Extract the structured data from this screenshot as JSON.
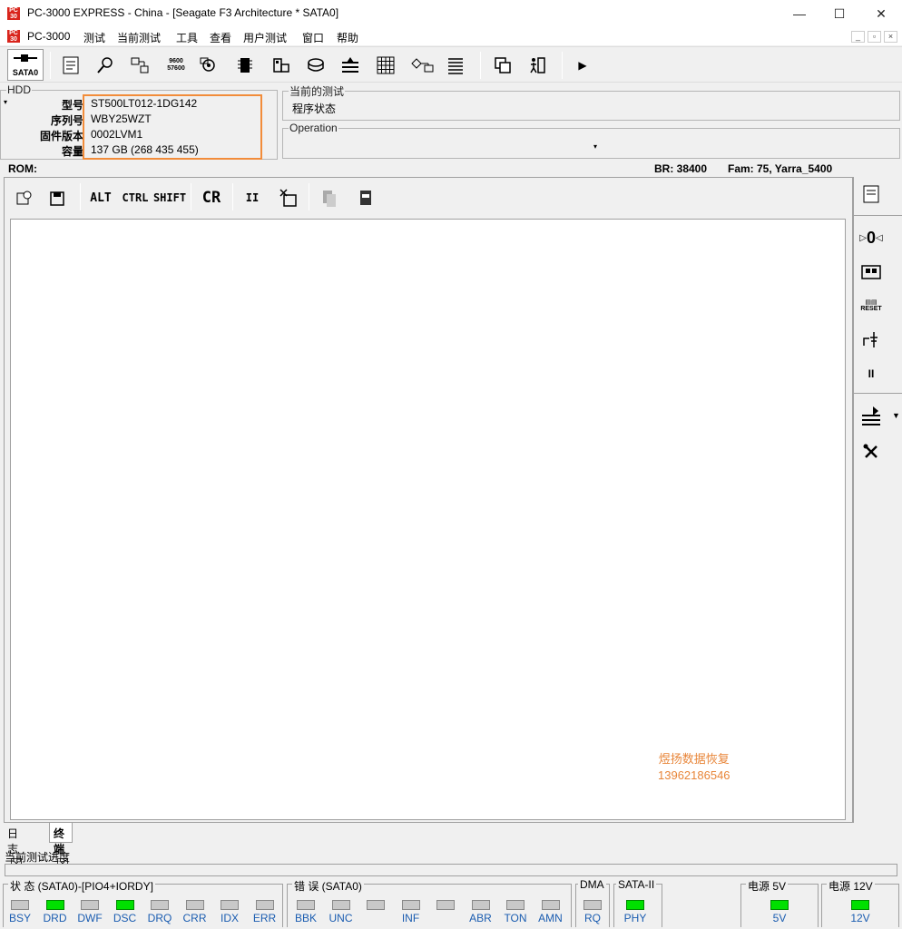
{
  "titlebar": {
    "title": "PC-3000 EXPRESS - China - [Seagate F3 Architecture * SATA0]",
    "icon_text": "PC\n3000"
  },
  "window_controls": {
    "minimize": "—",
    "maximize": "☐",
    "close": "✕"
  },
  "menubar": {
    "items": [
      "PC-3000",
      "测试",
      "当前测试",
      "工具",
      "查看",
      "用户测试",
      "窗口",
      "帮助"
    ]
  },
  "toolbar": {
    "sata_label": "SATA0",
    "more_glyph": "▶"
  },
  "hdd": {
    "legend": "HDD",
    "rows": [
      {
        "label": "型号",
        "value": "ST500LT012-1DG142"
      },
      {
        "label": "序列号",
        "value": "WBY25WZT"
      },
      {
        "label": "固件版本",
        "value": "0002LVM1"
      },
      {
        "label": "容量",
        "value": "137 GB (268 435 455)"
      }
    ]
  },
  "current_test": {
    "legend": "当前的测试",
    "value": "程序状态"
  },
  "operation": {
    "legend": "Operation",
    "value": ""
  },
  "rom_bar": {
    "rom": "ROM:",
    "br": "BR: 38400",
    "fam": "Fam: 75, Yarra_5400"
  },
  "terminal_toolbar": {
    "alt": "ALT",
    "ctrl": "CTRL",
    "shift": "SHIFT",
    "cr": "CR",
    "pause": "II"
  },
  "right_panel": {
    "zero": "0",
    "pause": "II"
  },
  "watermark": {
    "line1": "煜扬数据恢复",
    "line2": "13962186546"
  },
  "tabs": [
    {
      "label": "日志",
      "active": false
    },
    {
      "label": "终端",
      "active": true
    }
  ],
  "progress": {
    "label": "当前测试进度",
    "value": 0
  },
  "status": {
    "title": "状 态 (SATA0)-[PIO4+IORDY]",
    "leds": [
      {
        "label": "BSY",
        "on": false
      },
      {
        "label": "DRD",
        "on": true
      },
      {
        "label": "DWF",
        "on": false
      },
      {
        "label": "DSC",
        "on": true
      },
      {
        "label": "DRQ",
        "on": false
      },
      {
        "label": "CRR",
        "on": false
      },
      {
        "label": "IDX",
        "on": false
      },
      {
        "label": "ERR",
        "on": false
      }
    ]
  },
  "errors": {
    "title": "错 误 (SATA0)",
    "leds": [
      {
        "label": "BBK",
        "on": false
      },
      {
        "label": "UNC",
        "on": false
      },
      {
        "label": "",
        "on": false
      },
      {
        "label": "INF",
        "on": false
      },
      {
        "label": "",
        "on": false
      },
      {
        "label": "ABR",
        "on": false
      },
      {
        "label": "TON",
        "on": false
      },
      {
        "label": "AMN",
        "on": false
      }
    ]
  },
  "dma": {
    "title": "DMA",
    "leds": [
      {
        "label": "RQ",
        "on": false
      }
    ]
  },
  "sata2": {
    "title": "SATA-II",
    "leds": [
      {
        "label": "PHY",
        "on": true
      }
    ]
  },
  "power5": {
    "title": "电源 5V",
    "leds": [
      {
        "label": "5V",
        "on": true
      }
    ]
  },
  "power12": {
    "title": "电源 12V",
    "leds": [
      {
        "label": "12V",
        "on": true
      }
    ]
  },
  "colors": {
    "led_on": "#00e000",
    "led_off": "#c8c8c8",
    "highlight": "#f28c3a",
    "watermark": "#e8863a",
    "led_label": "#1a5cb0"
  }
}
